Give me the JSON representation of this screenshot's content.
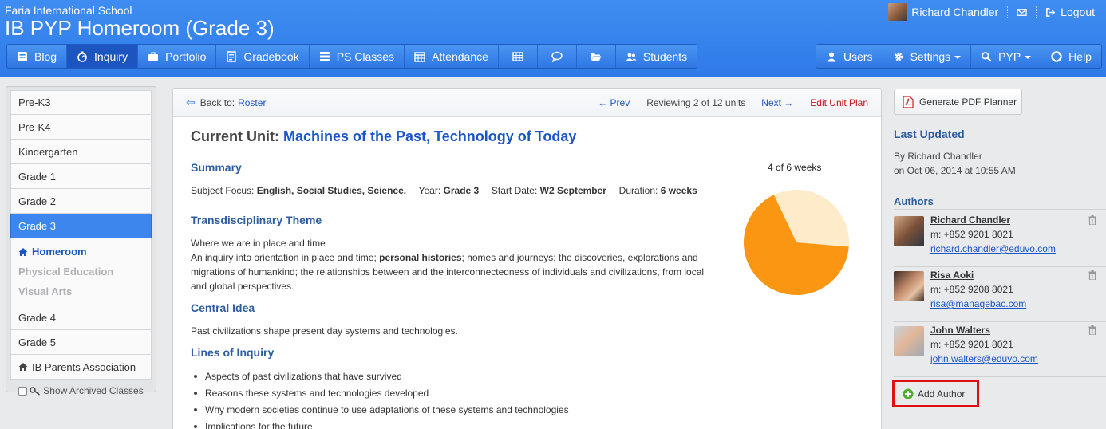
{
  "header": {
    "school_name": "Faria International School",
    "page_title": "IB PYP Homeroom (Grade 3)",
    "user_name": "Richard Chandler",
    "logout_label": "Logout"
  },
  "nav_left": [
    {
      "label": "Blog",
      "icon": "blog-icon"
    },
    {
      "label": "Inquiry",
      "icon": "stopwatch-icon",
      "active": true
    },
    {
      "label": "Portfolio",
      "icon": "briefcase-icon"
    },
    {
      "label": "Gradebook",
      "icon": "gradebook-icon"
    },
    {
      "label": "PS Classes",
      "icon": "server-icon"
    },
    {
      "label": "Attendance",
      "icon": "calendar-icon"
    },
    {
      "label": "",
      "icon": "table-icon"
    },
    {
      "label": "",
      "icon": "chat-bubble-icon"
    },
    {
      "label": "",
      "icon": "folder-open-icon"
    },
    {
      "label": "Students",
      "icon": "group-icon"
    }
  ],
  "nav_right": [
    {
      "label": "Users",
      "icon": "user-icon"
    },
    {
      "label": "Settings",
      "icon": "cog-icon",
      "dropdown": true
    },
    {
      "label": "PYP",
      "icon": "search-icon",
      "dropdown": true
    },
    {
      "label": "Help",
      "icon": "lifebuoy-icon"
    }
  ],
  "sidebar": {
    "items_top": [
      "Pre-K3",
      "Pre-K4",
      "Kindergarten",
      "Grade 1",
      "Grade 2"
    ],
    "active_item": "Grade 3",
    "sub_items": [
      {
        "label": "Homeroom",
        "current": true
      },
      {
        "label": "Physical Education",
        "current": false
      },
      {
        "label": "Visual Arts",
        "current": false
      }
    ],
    "items_bottom": [
      "Grade 4",
      "Grade 5"
    ],
    "parents_item": "IB Parents Association",
    "show_archived_label": "Show Archived Classes"
  },
  "unit_nav": {
    "back_to_label": "Back to:",
    "back_to_link": "Roster",
    "prev_label": "← Prev",
    "reviewing_text": "Reviewing 2 of 12 units",
    "next_label": "Next →",
    "edit_label": "Edit Unit Plan"
  },
  "unit": {
    "current_label": "Current Unit:",
    "name": "Machines of the Past, Technology of Today",
    "summary_heading": "Summary",
    "subject_focus_label": "Subject Focus:",
    "subject_focus": "English, Social Studies, Science.",
    "year_label": "Year:",
    "year": "Grade 3",
    "start_label": "Start Date:",
    "start": "W2 September",
    "duration_label": "Duration:",
    "duration": "6 weeks",
    "theme_heading": "Transdisciplinary Theme",
    "theme_title": "Where we are in place and time",
    "theme_desc_pre": "An inquiry into orientation in place and time;",
    "theme_desc_bold": "personal histories",
    "theme_desc_l1_post": "; homes and journeys; the discoveries, explorations and",
    "theme_desc_l2": "migrations of humankind; the relationships between and the interconnectedness of individuals and civilizations, from local",
    "theme_desc_l3": "and global perspectives.",
    "central_idea_heading": "Central Idea",
    "central_idea": "Past civilizations shape present day systems and technologies.",
    "loi_heading": "Lines of Inquiry",
    "lines_of_inquiry": [
      "Aspects of past civilizations that have survived",
      "Reasons these systems and technologies developed",
      "Why modern societies continue to use adaptations of these systems and technologies",
      "Implications for the future"
    ]
  },
  "progress": {
    "label": "4 of 6 weeks",
    "weeks_done": 4,
    "weeks_total": 6,
    "done_color": "#fa9611",
    "remaining_color": "#fdebc9"
  },
  "right": {
    "pdf_label": "Generate PDF Planner",
    "last_updated_heading": "Last Updated",
    "last_updated_by": "By Richard Chandler",
    "last_updated_on": "on Oct 06, 2014 at 10:55 AM",
    "authors_heading": "Authors",
    "authors": [
      {
        "name": "Richard Chandler",
        "phone": "m: +852 9201 8021",
        "email": "richard.chandler@eduvo.com"
      },
      {
        "name": "Risa Aoki",
        "phone": "m: +852 9208 8021",
        "email": "risa@managebac.com"
      },
      {
        "name": "John Walters",
        "phone": "m: +852 9201 8021",
        "email": "john.walters@eduvo.com"
      }
    ],
    "add_author_label": "Add Author"
  }
}
